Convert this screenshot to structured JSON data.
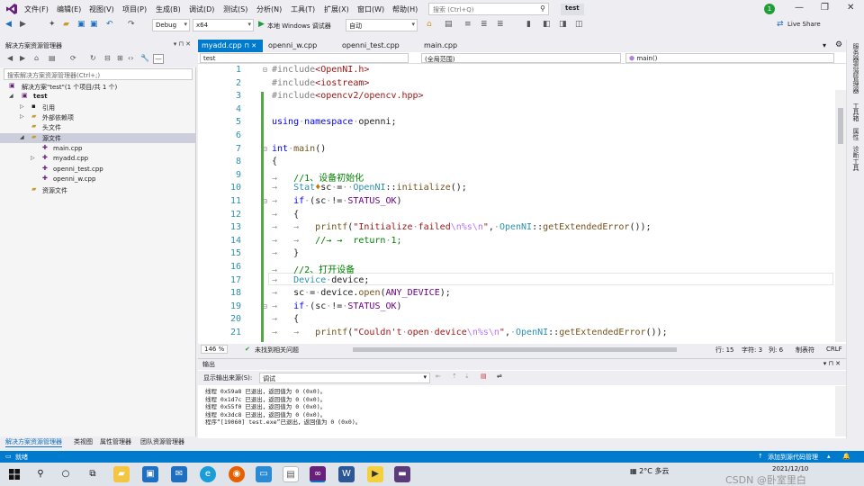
{
  "menu": {
    "items": [
      "文件(F)",
      "编辑(E)",
      "视图(V)",
      "项目(P)",
      "生成(B)",
      "调试(D)",
      "测试(S)",
      "分析(N)",
      "工具(T)",
      "扩展(X)",
      "窗口(W)",
      "帮助(H)"
    ],
    "search_placeholder": "搜索 (Ctrl+Q)",
    "solution_name": "test",
    "notification_count": "1"
  },
  "toolbar": {
    "config": "Debug",
    "platform": "x64",
    "debugger": "本地 Windows 调试器",
    "auto": "自动",
    "live_share": "Live Share"
  },
  "solution_explorer": {
    "title": "解决方案资源管理器",
    "search_placeholder": "搜索解决方案资源管理器(Ctrl+;)",
    "items": [
      {
        "label": "解决方案\"test\"(1 个项目/共 1 个)"
      },
      {
        "label": "test"
      },
      {
        "label": "引用"
      },
      {
        "label": "外部依赖项"
      },
      {
        "label": "头文件"
      },
      {
        "label": "源文件"
      },
      {
        "label": "main.cpp"
      },
      {
        "label": "myadd.cpp"
      },
      {
        "label": "openni_test.cpp"
      },
      {
        "label": "openni_w.cpp"
      },
      {
        "label": "资源文件"
      }
    ],
    "tabs": [
      "解决方案资源管理器",
      "类视图",
      "属性管理器",
      "团队资源管理器"
    ]
  },
  "editor": {
    "tabs": [
      "myadd.cpp",
      "openni_w.cpp",
      "openni_test.cpp",
      "main.cpp"
    ],
    "nav": {
      "project": "test",
      "scope": "(全局范围)",
      "member": "main()"
    },
    "line_numbers": [
      "1",
      "2",
      "3",
      "4",
      "5",
      "6",
      "7",
      "8",
      "9",
      "10",
      "11",
      "12",
      "13",
      "14",
      "15",
      "16",
      "17",
      "18",
      "19",
      "20",
      "21"
    ],
    "status": {
      "zoom": "146 %",
      "issues": "未找到相关问题",
      "line": "行: 15",
      "char": "字符: 3",
      "col": "列: 6",
      "tabs": "制表符",
      "eol": "CRLF"
    }
  },
  "right_strip": [
    "服务器资源管理器",
    "工具箱",
    "属性",
    "诊断工具"
  ],
  "output": {
    "title": "输出",
    "source_label": "显示输出来源(S):",
    "source_value": "调试",
    "lines": [
      "线程 0x59a8 已退出，返回值为 0 (0x0)。",
      "线程 0x1d7c 已退出，返回值为 0 (0x0)。",
      "线程 0x55f0 已退出，返回值为 0 (0x0)。",
      "线程 0x3dc8 已退出，返回值为 0 (0x0)。",
      "程序“[19060] test.exe”已退出，返回值为 0 (0x0)。"
    ]
  },
  "statusbar": {
    "ready": "就绪",
    "source_control": "添加到源代码管理"
  },
  "taskbar": {
    "weather": "2°C 多云",
    "time": "",
    "date": "2021/12/10",
    "watermark": "CSDN @卧室里白"
  },
  "colors": {
    "accent": "#007acc",
    "keyword": "#0000ff",
    "comment": "#008000",
    "string": "#a31515",
    "type": "#2b91af"
  }
}
